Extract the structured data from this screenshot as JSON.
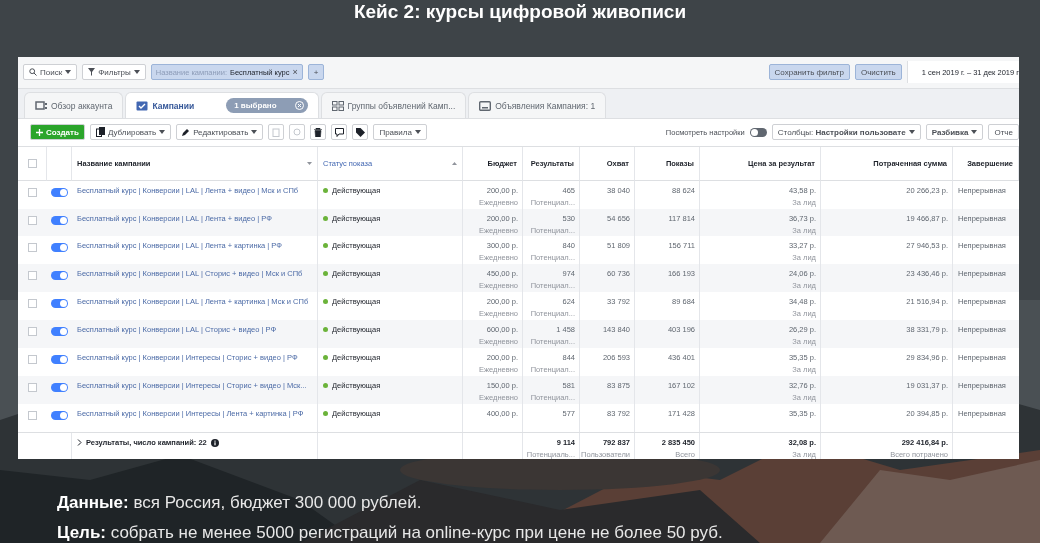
{
  "page_title": "Кейс 2: курсы цифровой живописи",
  "filter_bar": {
    "search": "Поиск",
    "filters": "Фильтры",
    "chip": {
      "label": "Название кампании:",
      "value": "Бесплатный курс",
      "remove": "×"
    },
    "add": "+",
    "save": "Сохранить фильтр",
    "clear": "Очистить",
    "date_range": "1 сен 2019 г. – 31 дек 2019 г"
  },
  "tabs": [
    {
      "label": "Обзор аккаунта",
      "selected": false
    },
    {
      "label": "Кампании",
      "selected": true,
      "chip": "1 выбрано"
    },
    {
      "label": "Группы объявлений Камп...",
      "selected": false
    },
    {
      "label": "Объявления Кампания: 1",
      "selected": false
    }
  ],
  "toolbar": {
    "create": "Создать",
    "duplicate": "Дублировать",
    "edit": "Редактировать",
    "rules": "Правила",
    "view_settings": {
      "label": "Посмотреть настройки",
      "on": false
    },
    "columns": "Столбцы: **Настройки пользовате**",
    "breakdown": "Разбивка",
    "reports": "Отче"
  },
  "table": {
    "all_checked": false,
    "columns": [
      {
        "label": "Название кампании",
        "sorted": false
      },
      {
        "label": "Статус показа",
        "sorted": true
      },
      {
        "label": "Бюджет",
        "sorted": false
      },
      {
        "label": "Результаты",
        "sorted": false
      },
      {
        "label": "Охват",
        "sorted": false
      },
      {
        "label": "Показы",
        "sorted": false
      },
      {
        "label": "Цена за результат",
        "sorted": false
      },
      {
        "label": "Потраченная сумма",
        "sorted": false
      },
      {
        "label": "Завершение",
        "sorted": false
      }
    ],
    "rows": [
      {
        "checked": false,
        "on": true,
        "name": "Бесплатный курс | Конверсии | LAL | Лента + видео | Мск и СПб",
        "status": "Действующая",
        "budget": "200,00 р.",
        "budget_note": "Ежедневно",
        "results": "465",
        "results_note": "Потенциал...",
        "reach": "38 040",
        "impressions": "88 624",
        "cost": "43,58 р.",
        "cost_note": "За лид",
        "spent": "20 266,23 р.",
        "end": "Непрерывная"
      },
      {
        "checked": false,
        "on": true,
        "name": "Бесплатный курс | Конверсии | LAL | Лента + видео | РФ",
        "status": "Действующая",
        "budget": "200,00 р.",
        "budget_note": "Ежедневно",
        "results": "530",
        "results_note": "Потенциал...",
        "reach": "54 656",
        "impressions": "117 814",
        "cost": "36,73 р.",
        "cost_note": "За лид",
        "spent": "19 466,87 р.",
        "end": "Непрерывная"
      },
      {
        "checked": false,
        "on": true,
        "name": "Бесплатный курс | Конверсии | LAL | Лента + картинка | РФ",
        "status": "Действующая",
        "budget": "300,00 р.",
        "budget_note": "Ежедневно",
        "results": "840",
        "results_note": "Потенциал...",
        "reach": "51 809",
        "impressions": "156 711",
        "cost": "33,27 р.",
        "cost_note": "За лид",
        "spent": "27 946,53 р.",
        "end": "Непрерывная"
      },
      {
        "checked": false,
        "on": true,
        "name": "Бесплатный курс | Конверсии | LAL | Сторис + видео | Мск и СПб",
        "status": "Действующая",
        "budget": "450,00 р.",
        "budget_note": "Ежедневно",
        "results": "974",
        "results_note": "Потенциал...",
        "reach": "60 736",
        "impressions": "166 193",
        "cost": "24,06 р.",
        "cost_note": "За лид",
        "spent": "23 436,46 р.",
        "end": "Непрерывная"
      },
      {
        "checked": false,
        "on": true,
        "name": "Бесплатный курс | Конверсии | LAL | Лента + картинка | Мск и СПб",
        "status": "Действующая",
        "budget": "200,00 р.",
        "budget_note": "Ежедневно",
        "results": "624",
        "results_note": "Потенциал...",
        "reach": "33 792",
        "impressions": "89 684",
        "cost": "34,48 р.",
        "cost_note": "За лид",
        "spent": "21 516,94 р.",
        "end": "Непрерывная"
      },
      {
        "checked": false,
        "on": true,
        "name": "Бесплатный курс | Конверсии | LAL | Сторис + видео | РФ",
        "status": "Действующая",
        "budget": "600,00 р.",
        "budget_note": "Ежедневно",
        "results": "1 458",
        "results_note": "Потенциал...",
        "reach": "143 840",
        "impressions": "403 196",
        "cost": "26,29 р.",
        "cost_note": "За лид",
        "spent": "38 331,79 р.",
        "end": "Непрерывная"
      },
      {
        "checked": false,
        "on": true,
        "name": "Бесплатный курс | Конверсии | Интересы | Сторис + видео | РФ",
        "status": "Действующая",
        "budget": "200,00 р.",
        "budget_note": "Ежедневно",
        "results": "844",
        "results_note": "Потенциал...",
        "reach": "206 593",
        "impressions": "436 401",
        "cost": "35,35 р.",
        "cost_note": "За лид",
        "spent": "29 834,96 р.",
        "end": "Непрерывная"
      },
      {
        "checked": false,
        "on": true,
        "name": "Бесплатный курс | Конверсии | Интересы | Сторис + видео | Мск...",
        "status": "Действующая",
        "budget": "150,00 р.",
        "budget_note": "Ежедневно",
        "results": "581",
        "results_note": "Потенциал...",
        "reach": "83 875",
        "impressions": "167 102",
        "cost": "32,76 р.",
        "cost_note": "За лид",
        "spent": "19 031,37 р.",
        "end": "Непрерывная"
      },
      {
        "checked": false,
        "on": true,
        "name": "Бесплатный курс | Конверсии | Интересы | Лента + картинка | РФ",
        "status": "Действующая",
        "budget": "400,00 р.",
        "results": "577",
        "reach": "83 792",
        "impressions": "171 428",
        "cost": "35,35 р.",
        "spent": "20 394,85 р.",
        "end": "Непрерывная"
      }
    ],
    "footer": {
      "summary": "Результаты, число кампаний: 22",
      "results": "9 114",
      "results_note": "Потенциаль...",
      "reach": "792 837",
      "reach_note": "Пользователи",
      "impressions": "2 835 450",
      "impressions_note": "Всего",
      "cost": "32,08 р.",
      "cost_note": "За лид",
      "spent": "292 416,84 р.",
      "spent_note": "Всего потрачено"
    }
  },
  "notes": [
    "**Данные:** вся Россия, бюджет 300 000 рублей.",
    "**Цель:** собрать не менее 5000 регистраций на online-курс при цене не более 50 руб."
  ]
}
